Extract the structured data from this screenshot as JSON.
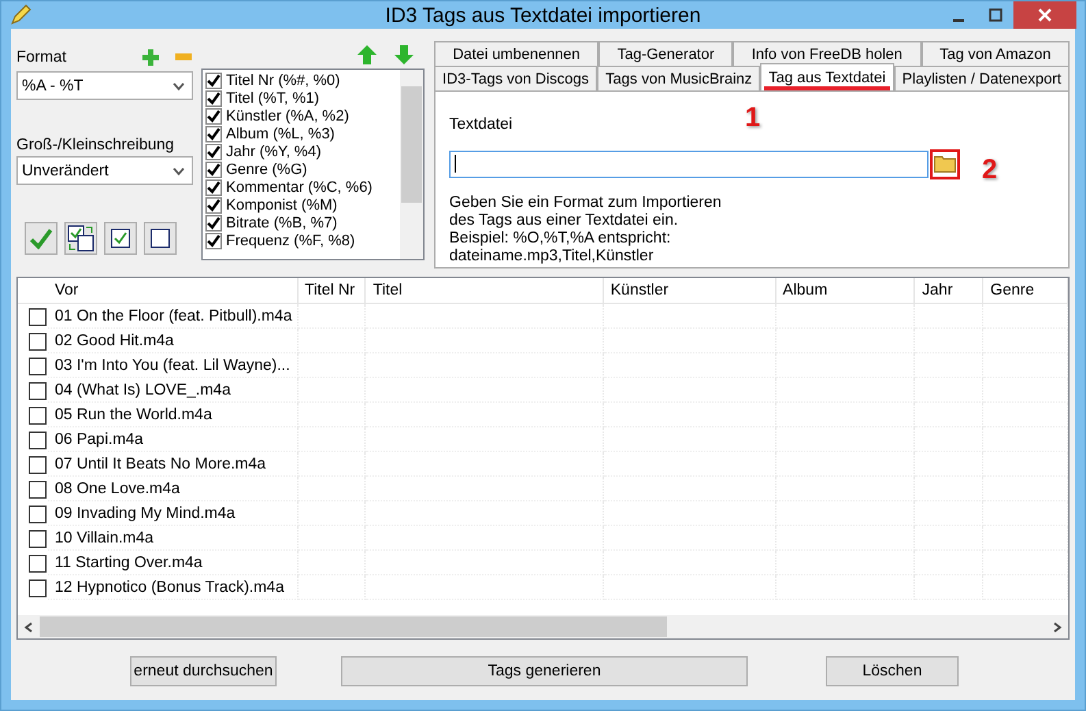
{
  "window": {
    "title": "ID3 Tags aus Textdatei importieren"
  },
  "format": {
    "label": "Format",
    "value": "%A - %T"
  },
  "case": {
    "label": "Groß-/Kleinschreibung",
    "value": "Unverändert"
  },
  "fields": [
    {
      "label": "Titel Nr (%#, %0)",
      "checked": true
    },
    {
      "label": "Titel (%T, %1)",
      "checked": true
    },
    {
      "label": "Künstler (%A, %2)",
      "checked": true
    },
    {
      "label": "Album (%L, %3)",
      "checked": true
    },
    {
      "label": "Jahr (%Y, %4)",
      "checked": true
    },
    {
      "label": "Genre (%G)",
      "checked": true
    },
    {
      "label": "Kommentar (%C, %6)",
      "checked": true
    },
    {
      "label": "Komponist (%M)",
      "checked": true
    },
    {
      "label": "Bitrate (%B, %7)",
      "checked": true
    },
    {
      "label": "Frequenz (%F, %8)",
      "checked": true
    }
  ],
  "tab_rows": [
    [
      {
        "label": "Datei umbenennen",
        "selected": false
      },
      {
        "label": "Tag-Generator",
        "selected": false
      },
      {
        "label": "Info von FreeDB holen",
        "selected": false
      },
      {
        "label": "Tag von Amazon",
        "selected": false
      }
    ],
    [
      {
        "label": "ID3-Tags von Discogs",
        "selected": false
      },
      {
        "label": "Tags von MusicBrainz",
        "selected": false
      },
      {
        "label": "Tag aus Textdatei",
        "selected": true
      },
      {
        "label": "Playlisten / Datenexport",
        "selected": false
      }
    ]
  ],
  "textfile": {
    "label": "Textdatei",
    "description_lines": [
      "Geben Sie ein Format zum Importieren",
      "des Tags aus einer Textdatei ein.",
      "Beispiel: %O,%T,%A entspricht:",
      "dateiname.mp3,Titel,Künstler"
    ]
  },
  "annotations": [
    {
      "label": "1"
    },
    {
      "label": "2"
    }
  ],
  "table": {
    "columns": [
      "Vor",
      "Titel Nr",
      "Titel",
      "Künstler",
      "Album",
      "Jahr",
      "Genre"
    ],
    "rows": [
      {
        "checked": false,
        "name": "01 On the Floor (feat. Pitbull).m4a"
      },
      {
        "checked": false,
        "name": "02 Good Hit.m4a"
      },
      {
        "checked": false,
        "name": "03 I'm Into You (feat. Lil Wayne)..."
      },
      {
        "checked": false,
        "name": "04 (What Is) LOVE_.m4a"
      },
      {
        "checked": false,
        "name": "05 Run the World.m4a"
      },
      {
        "checked": false,
        "name": "06 Papi.m4a"
      },
      {
        "checked": false,
        "name": "07 Until It Beats No More.m4a"
      },
      {
        "checked": false,
        "name": "08 One Love.m4a"
      },
      {
        "checked": false,
        "name": "09 Invading My Mind.m4a"
      },
      {
        "checked": false,
        "name": "10 Villain.m4a"
      },
      {
        "checked": false,
        "name": "11 Starting Over.m4a"
      },
      {
        "checked": false,
        "name": "12 Hypnotico (Bonus Track).m4a"
      }
    ]
  },
  "buttons": [
    "erneut durchsuchen",
    "Tags generieren",
    "Löschen"
  ]
}
